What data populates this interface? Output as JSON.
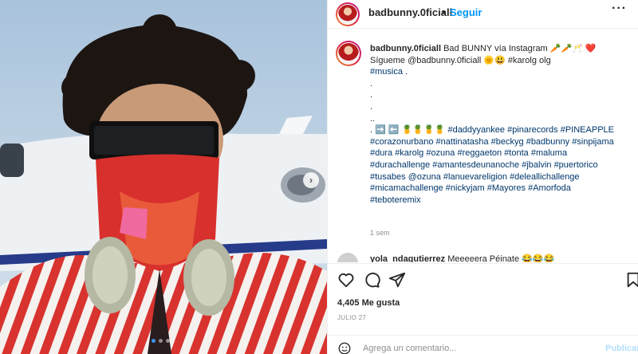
{
  "post": {
    "username": "badbunny.0ficiall",
    "separator": "•",
    "follow_label": "Seguir",
    "more_label": "···",
    "media_alt": "selfie with bandana and headphones in front of airplane"
  },
  "caption": {
    "username": "badbunny.0ficiall",
    "lines": [
      "Bad BUNNY vía Instagram 🥕🥕🥂 ❤️",
      "Sígueme @badbunny.0ficiall 🌞😃 #karolg olg",
      "#musica .",
      ".",
      ".",
      ".",
      "..",
      ". ➡️ ⬅️ 🍍🍍🍍🍍 #daddyyankee #pinarecords #PINEAPPLE",
      "#corazonurbano #nattinatasha #beckyg #badbunny #sinpijama",
      "#dura #karolg #ozuna #reggaeton #tonta #maluma",
      "#durachallenge #amantesdeunanoche #jbalvin #puertorico",
      "#tusabes @ozuna #lanuevareligion #deleallichallenge",
      "#micamachallenge #nickyjam #Mayores #Amorfoda",
      "#teboteremix"
    ],
    "time": "1 sem"
  },
  "comment2": {
    "username": "yola_ndagutierrez",
    "text": "Meeeeera Péinate 😂😂😂"
  },
  "actions": {
    "like_icon": "heart-icon",
    "comment_icon": "comment-icon",
    "share_icon": "share-icon",
    "save_icon": "bookmark-icon"
  },
  "likes": "4,405 Me gusta",
  "date": "JULIO 27",
  "add_comment": {
    "placeholder": "Agrega un comentario...",
    "post_label": "Publicar"
  },
  "colors": {
    "link": "#0095f6",
    "hashtag": "#00376b",
    "muted": "#8e8e8e",
    "border": "#efefef"
  },
  "carousel": {
    "next_label": "›",
    "dots": 3,
    "active_dot": 1
  }
}
